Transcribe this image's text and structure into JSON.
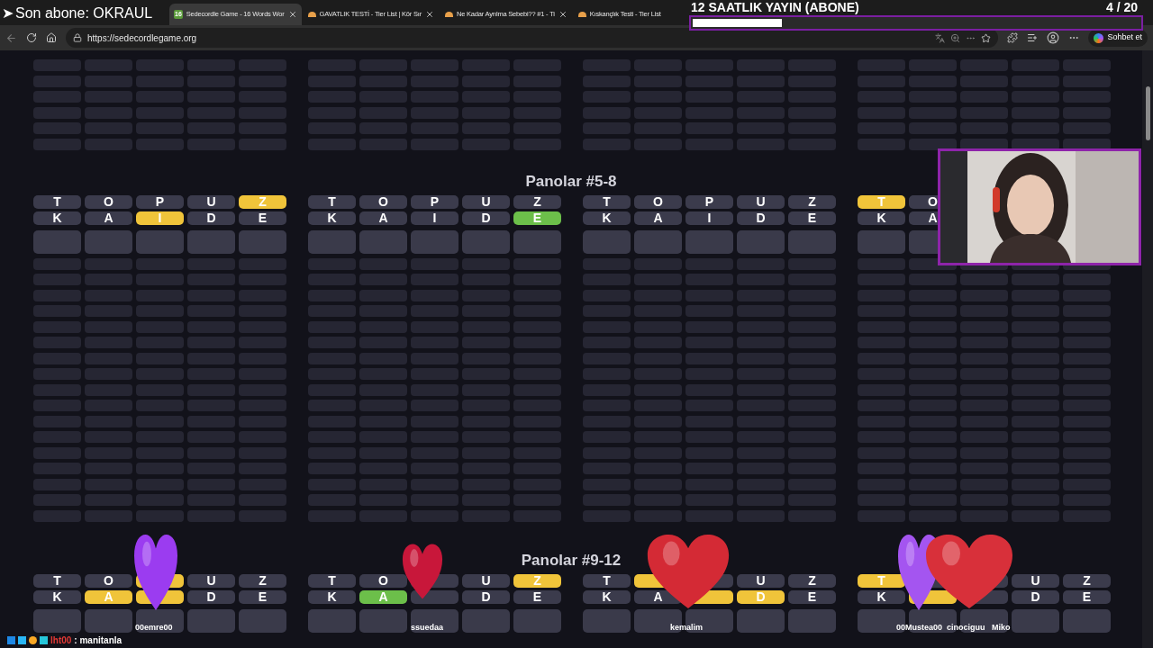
{
  "browser": {
    "tabs": [
      {
        "title": "Sedecordle Game - 16 Words Wor",
        "icon": "16",
        "selected": true
      },
      {
        "title": "GAVATLIK TESTİ - Tier List | Kör Sır",
        "selected": false
      },
      {
        "title": "Ne Kadar Ayrılma Sebebi?? #1 - Ti",
        "selected": false
      },
      {
        "title": "Kıskançlık Testi - Tier List",
        "selected": false
      }
    ],
    "url": "https://sedecordlegame.org",
    "chat_button": "Sohbet et"
  },
  "sections": [
    {
      "title": "Panolar #5-8",
      "boards": [
        {
          "guesses": [
            [
              {
                "letter": "T",
                "color": "#3b3b4c"
              },
              {
                "letter": "O",
                "color": "#3b3b4c"
              },
              {
                "letter": "P",
                "color": "#3b3b4c"
              },
              {
                "letter": "U",
                "color": "#3b3b4c"
              },
              {
                "letter": "Z",
                "color": "#f0c43a"
              }
            ],
            [
              {
                "letter": "K",
                "color": "#3b3b4c"
              },
              {
                "letter": "A",
                "color": "#3b3b4c"
              },
              {
                "letter": "I",
                "color": "#f0c43a"
              },
              {
                "letter": "D",
                "color": "#3b3b4c"
              },
              {
                "letter": "E",
                "color": "#3b3b4c"
              }
            ]
          ]
        },
        {
          "guesses": [
            [
              {
                "letter": "T",
                "color": "#3b3b4c"
              },
              {
                "letter": "O",
                "color": "#3b3b4c"
              },
              {
                "letter": "P",
                "color": "#3b3b4c"
              },
              {
                "letter": "U",
                "color": "#3b3b4c"
              },
              {
                "letter": "Z",
                "color": "#3b3b4c"
              }
            ],
            [
              {
                "letter": "K",
                "color": "#3b3b4c"
              },
              {
                "letter": "A",
                "color": "#3b3b4c"
              },
              {
                "letter": "I",
                "color": "#3b3b4c"
              },
              {
                "letter": "D",
                "color": "#3b3b4c"
              },
              {
                "letter": "E",
                "color": "#6cbf4a"
              }
            ]
          ]
        },
        {
          "guesses": [
            [
              {
                "letter": "T",
                "color": "#3b3b4c"
              },
              {
                "letter": "O",
                "color": "#3b3b4c"
              },
              {
                "letter": "P",
                "color": "#3b3b4c"
              },
              {
                "letter": "U",
                "color": "#3b3b4c"
              },
              {
                "letter": "Z",
                "color": "#3b3b4c"
              }
            ],
            [
              {
                "letter": "K",
                "color": "#3b3b4c"
              },
              {
                "letter": "A",
                "color": "#3b3b4c"
              },
              {
                "letter": "I",
                "color": "#3b3b4c"
              },
              {
                "letter": "D",
                "color": "#3b3b4c"
              },
              {
                "letter": "E",
                "color": "#3b3b4c"
              }
            ]
          ]
        },
        {
          "guesses": [
            [
              {
                "letter": "T",
                "color": "#f0c43a"
              },
              {
                "letter": "O",
                "color": "#3b3b4c"
              }
            ],
            [
              {
                "letter": "K",
                "color": "#3b3b4c"
              },
              {
                "letter": "A",
                "color": "#3b3b4c"
              }
            ]
          ]
        }
      ]
    },
    {
      "title": "Panolar #9-12",
      "boards": [
        {
          "guesses": [
            [
              {
                "letter": "T",
                "color": "#3b3b4c"
              },
              {
                "letter": "O",
                "color": "#3b3b4c"
              },
              {
                "color": "#f0c43a"
              },
              {
                "letter": "U",
                "color": "#3b3b4c"
              },
              {
                "letter": "Z",
                "color": "#3b3b4c"
              }
            ],
            [
              {
                "letter": "K",
                "color": "#3b3b4c"
              },
              {
                "letter": "A",
                "color": "#f0c43a"
              },
              {
                "color": "#f0c43a"
              },
              {
                "letter": "D",
                "color": "#3b3b4c"
              },
              {
                "letter": "E",
                "color": "#3b3b4c"
              }
            ]
          ]
        },
        {
          "guesses": [
            [
              {
                "letter": "T",
                "color": "#3b3b4c"
              },
              {
                "letter": "O",
                "color": "#3b3b4c"
              },
              {
                "color": "#3b3b4c"
              },
              {
                "letter": "U",
                "color": "#3b3b4c"
              },
              {
                "letter": "Z",
                "color": "#f0c43a"
              }
            ],
            [
              {
                "letter": "K",
                "color": "#3b3b4c"
              },
              {
                "letter": "A",
                "color": "#6cbf4a"
              },
              {
                "color": "#3b3b4c"
              },
              {
                "letter": "D",
                "color": "#3b3b4c"
              },
              {
                "letter": "E",
                "color": "#3b3b4c"
              }
            ]
          ]
        },
        {
          "guesses": [
            [
              {
                "letter": "T",
                "color": "#3b3b4c"
              },
              {
                "color": "#f0c43a"
              },
              {
                "color": "#3b3b4c"
              },
              {
                "letter": "U",
                "color": "#3b3b4c"
              },
              {
                "letter": "Z",
                "color": "#3b3b4c"
              }
            ],
            [
              {
                "letter": "K",
                "color": "#3b3b4c"
              },
              {
                "letter": "A",
                "color": "#3b3b4c"
              },
              {
                "color": "#f0c43a"
              },
              {
                "letter": "D",
                "color": "#f0c43a"
              },
              {
                "letter": "E",
                "color": "#3b3b4c"
              }
            ]
          ]
        },
        {
          "guesses": [
            [
              {
                "letter": "T",
                "color": "#f0c43a"
              },
              {
                "color": "#3b3b4c"
              },
              {
                "color": "#3b3b4c"
              },
              {
                "letter": "U",
                "color": "#3b3b4c"
              },
              {
                "letter": "Z",
                "color": "#3b3b4c"
              }
            ],
            [
              {
                "letter": "K",
                "color": "#3b3b4c"
              },
              {
                "color": "#f0c43a"
              },
              {
                "color": "#3b3b4c"
              },
              {
                "letter": "D",
                "color": "#3b3b4c"
              },
              {
                "letter": "E",
                "color": "#3b3b4c"
              }
            ]
          ]
        }
      ]
    }
  ],
  "stream": {
    "last_subscriber_marker": "➤",
    "last_subscriber": "Son abone: OKRAUL",
    "goal": {
      "title": "12 SAATLIK YAYIN (ABONE)",
      "level": 0.2,
      "count": "4  / 20"
    },
    "viewers": [
      "00emre00",
      "ssuedaa",
      "kemalim",
      "00Mustea00",
      "cinociguu",
      "Miko"
    ],
    "chat": [
      {
        "user": "lht00",
        "message": ": manitanla"
      }
    ]
  }
}
